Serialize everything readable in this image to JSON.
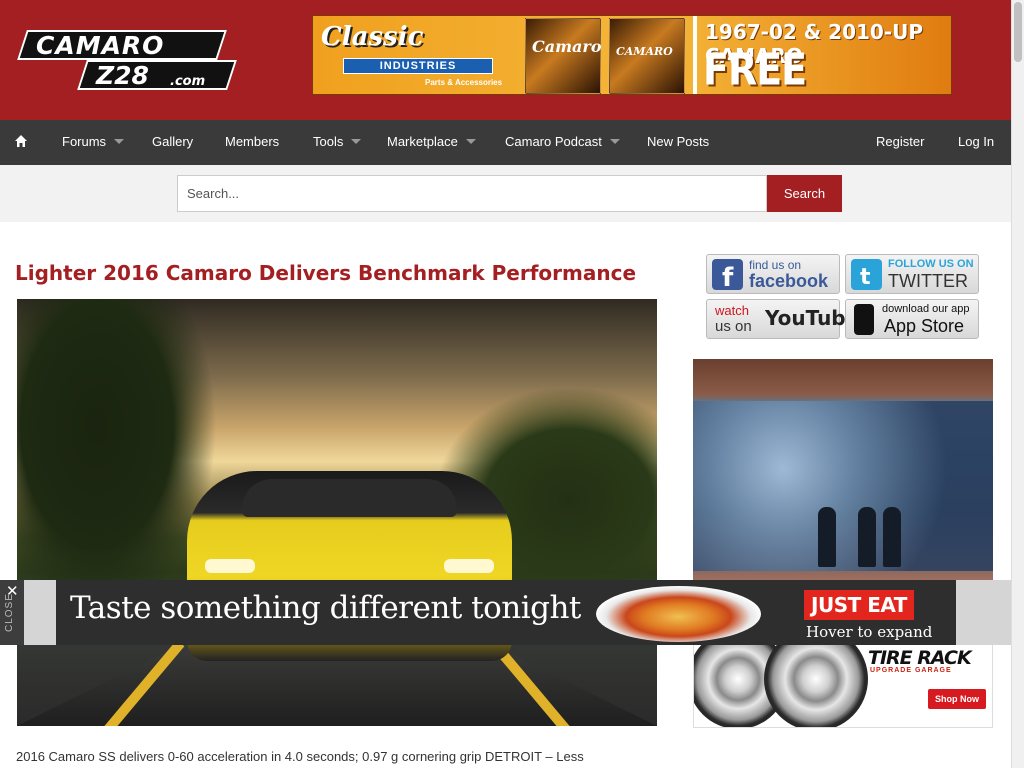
{
  "header": {
    "logo_line1": "CAMARO",
    "logo_line2": "Z28",
    "logo_line3": ".com",
    "banner": {
      "brand": "Classic",
      "brand_bar": "INDUSTRIES",
      "brand_sub": "Parts & Accessories",
      "mag1": "Camaro",
      "mag2": "CAMARO",
      "years": "1967-02 & 2010-UP CAMARO",
      "headline": "FREE CATALOG!"
    }
  },
  "nav": {
    "home_icon": "home-icon",
    "items": [
      {
        "label": "Forums"
      },
      {
        "label": "Gallery"
      },
      {
        "label": "Members"
      },
      {
        "label": "Tools"
      },
      {
        "label": "Marketplace"
      },
      {
        "label": "Camaro Podcast"
      },
      {
        "label": "New Posts"
      }
    ],
    "register": "Register",
    "login": "Log In"
  },
  "search": {
    "placeholder": "Search...",
    "button": "Search"
  },
  "article": {
    "title": "Lighter 2016 Camaro Delivers Benchmark Performance",
    "excerpt": "2016 Camaro SS delivers 0-60 acceleration in 4.0 seconds; 0.97 g cornering grip DETROIT – Less"
  },
  "sidebar": {
    "social": [
      {
        "line1": "find us on",
        "line2": "facebook",
        "icon": "facebook-icon",
        "color": "#3b5998"
      },
      {
        "line1": "FOLLOW US ON",
        "line2": "TWITTER",
        "icon": "twitter-icon",
        "color": "#2aa4d8"
      },
      {
        "line1": "watch",
        "line1b": "us on",
        "line2": "YouTube",
        "icon": "youtube-icon",
        "color": "#cc181e"
      },
      {
        "line1": "download our app",
        "line2": "App Store",
        "icon": "phone-icon",
        "color": "#111111"
      }
    ],
    "tire_ad": {
      "brand": "TIRE RACK",
      "sub": "UPGRADE GARAGE",
      "cta": "Shop Now"
    }
  },
  "overlay_ad": {
    "close": "✕",
    "close_label": "CLOSE",
    "tagline": "Taste something different tonight",
    "badge": "JUST EAT",
    "hint": "Hover to expand"
  },
  "colors": {
    "brand_red": "#a31f22",
    "nav_bg": "#3a3a3a"
  }
}
